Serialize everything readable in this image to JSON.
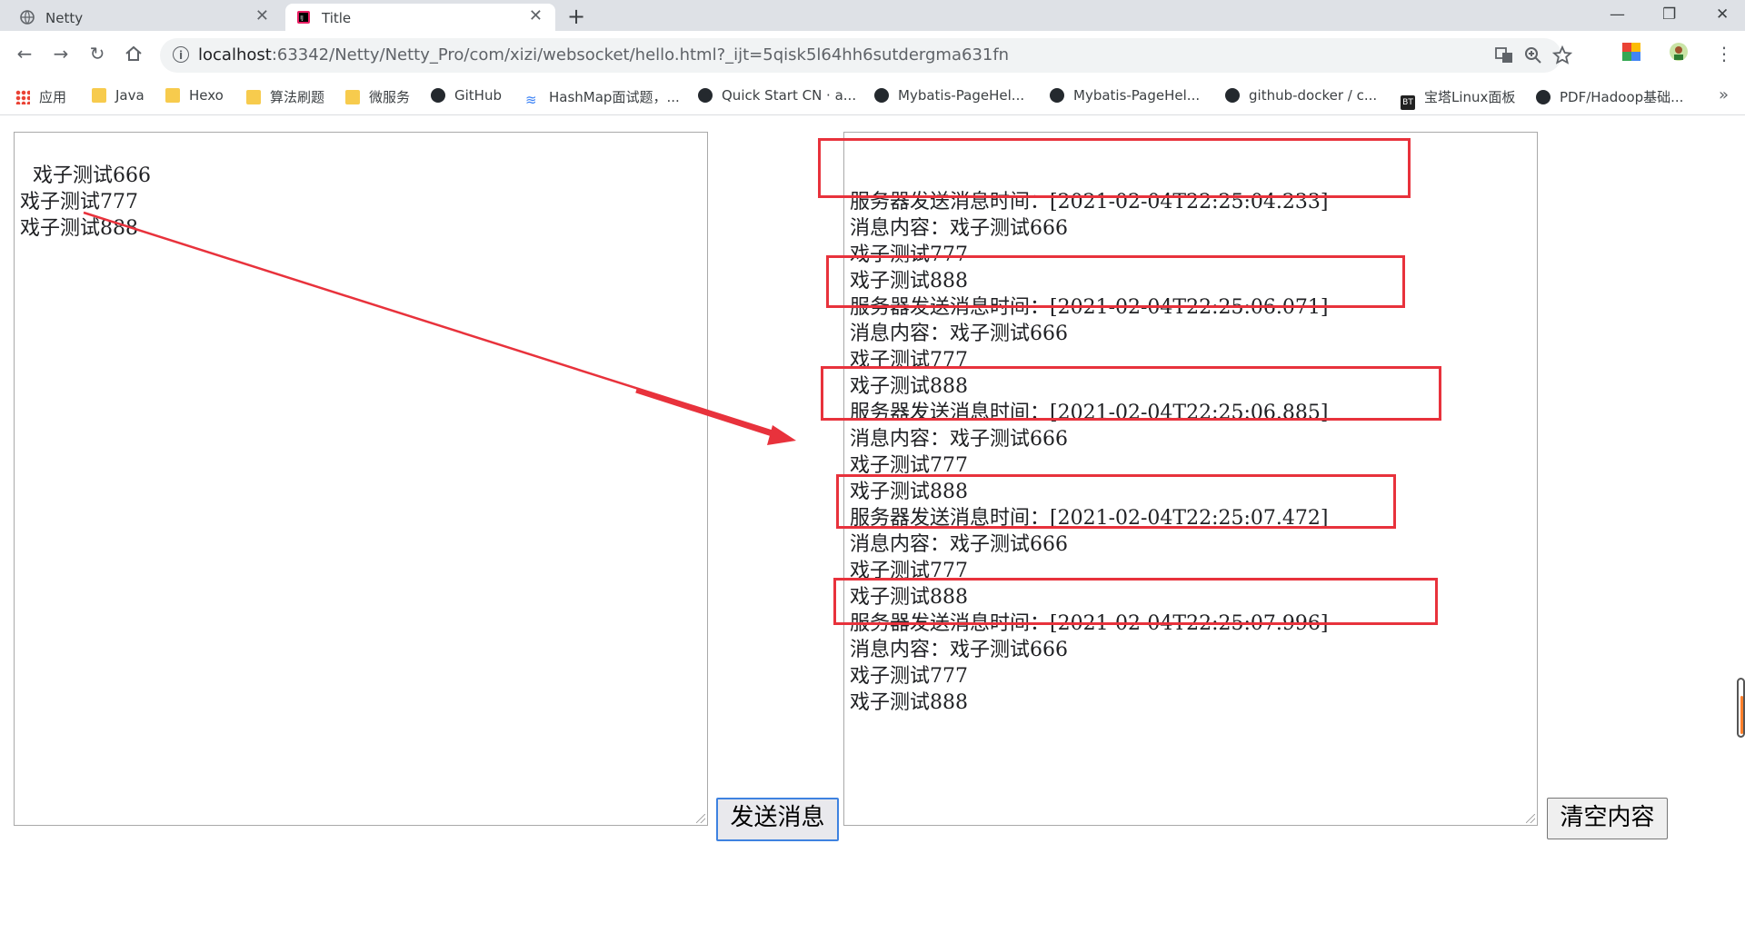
{
  "browser": {
    "tabs": [
      {
        "title": "Netty",
        "icon": "globe-icon",
        "active": false
      },
      {
        "title": "Title",
        "icon": "intellij-icon",
        "active": true
      }
    ],
    "new_tab_label": "+",
    "window_controls": {
      "minimize": "—",
      "restore": "❐",
      "close": "✕"
    },
    "url_host": "localhost",
    "url_rest": ":63342/Netty/Netty_Pro/com/xizi/websocket/hello.html?_ijt=5qisk5l64hh6sutdergma631fn",
    "bookmarks": [
      {
        "label": "应用",
        "icon": "apps-icon"
      },
      {
        "label": "Java",
        "icon": "folder-icon"
      },
      {
        "label": "Hexo",
        "icon": "folder-icon"
      },
      {
        "label": "算法刷题",
        "icon": "folder-icon"
      },
      {
        "label": "微服务",
        "icon": "folder-icon"
      },
      {
        "label": "GitHub",
        "icon": "github-icon"
      },
      {
        "label": "HashMap面试题，...",
        "icon": "bookmark-icon"
      },
      {
        "label": "Quick Start CN · a...",
        "icon": "github-icon"
      },
      {
        "label": "Mybatis-PageHel...",
        "icon": "github-icon"
      },
      {
        "label": "Mybatis-PageHel...",
        "icon": "github-icon"
      },
      {
        "label": "github-docker / c...",
        "icon": "github-icon"
      },
      {
        "label": "宝塔Linux面板",
        "icon": "bt-icon"
      },
      {
        "label": "PDF/Hadoop基础...",
        "icon": "github-icon"
      }
    ],
    "bookmarks_more": "»"
  },
  "page": {
    "input_text": "戏子测试666\n戏子测试777\n戏子测试888",
    "send_button": "发送消息",
    "clear_button": "清空内容",
    "output_text": "\n服务器发送消息时间：[2021-02-04T22:25:04.233]\n消息内容：戏子测试666\n戏子测试777\n戏子测试888\n服务器发送消息时间：[2021-02-04T22:25:06.071]\n消息内容：戏子测试666\n戏子测试777\n戏子测试888\n服务器发送消息时间：[2021-02-04T22:25:06.885]\n消息内容：戏子测试666\n戏子测试777\n戏子测试888\n服务器发送消息时间：[2021-02-04T22:25:07.472]\n消息内容：戏子测试666\n戏子测试777\n戏子测试888\n服务器发送消息时间：[2021-02-04T22:25:07.996]\n消息内容：戏子测试666\n戏子测试777\n戏子测试888"
  },
  "annotation_color": "#e8323c"
}
